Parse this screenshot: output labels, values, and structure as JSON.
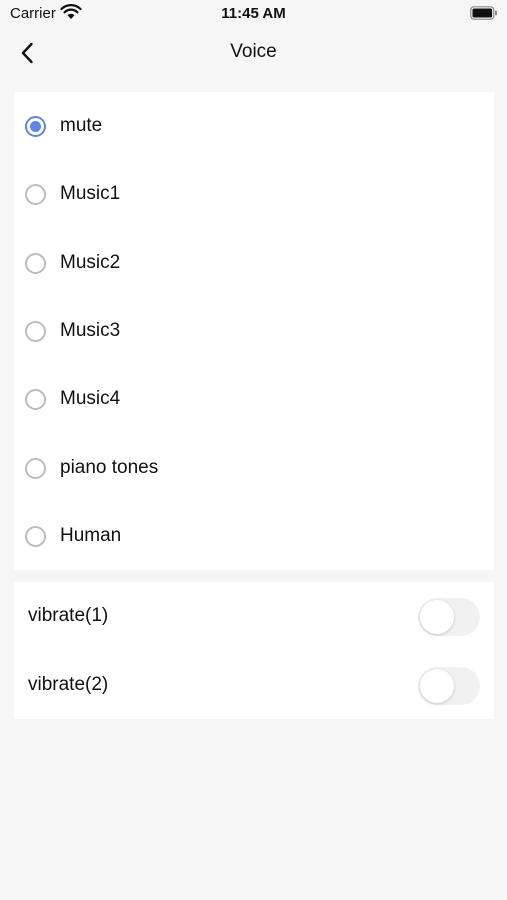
{
  "status_bar": {
    "carrier": "Carrier",
    "time": "11:45 AM"
  },
  "nav": {
    "title": "Voice",
    "back_icon": "chevron-left-icon"
  },
  "sound_options": [
    {
      "label": "mute",
      "selected": true
    },
    {
      "label": "Music1",
      "selected": false
    },
    {
      "label": "Music2",
      "selected": false
    },
    {
      "label": "Music3",
      "selected": false
    },
    {
      "label": "Music4",
      "selected": false
    },
    {
      "label": "piano tones",
      "selected": false
    },
    {
      "label": "Human",
      "selected": false
    }
  ],
  "vibrate_options": [
    {
      "label": "vibrate(1)",
      "on": false
    },
    {
      "label": "vibrate(2)",
      "on": false
    }
  ],
  "colors": {
    "accent": "#5f86e6",
    "background": "#f6f6f6",
    "card": "#ffffff"
  }
}
